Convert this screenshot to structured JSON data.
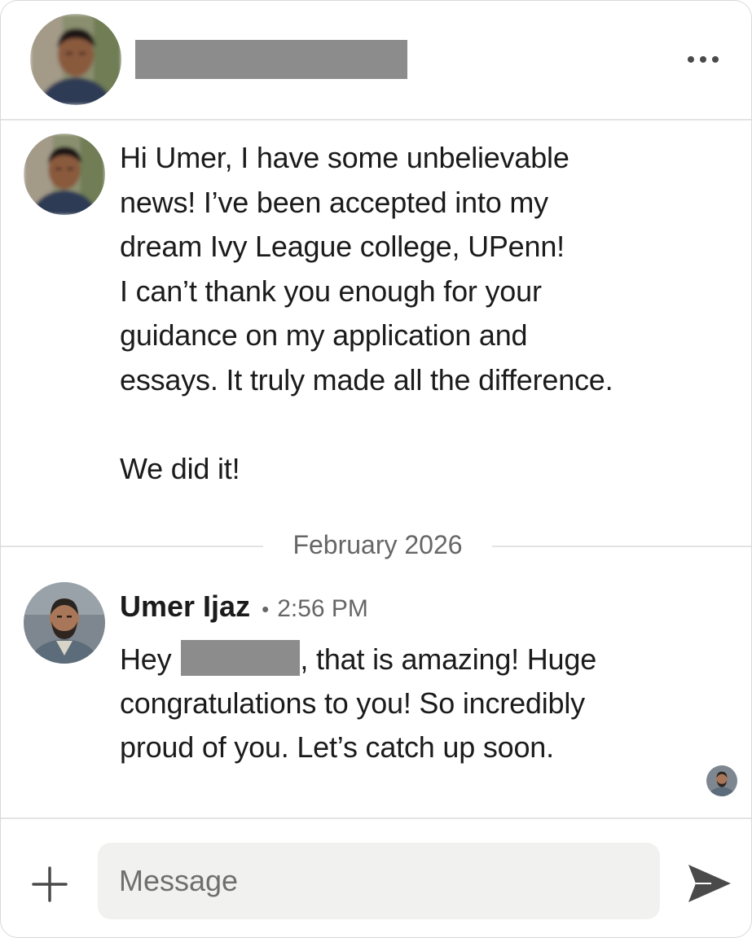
{
  "header": {
    "contact_name_redacted": true,
    "more_icon": "ellipsis-icon"
  },
  "messages": [
    {
      "body": "Hi Umer, I have some unbelievable\nnews! I’ve been accepted into my\ndream Ivy League college, UPenn!\nI can’t thank you enough for your\nguidance on my application and\nessays. It truly made all the difference.\n\nWe did it!"
    },
    {
      "sender": "Umer Ijaz",
      "separator": "•",
      "time": "2:56 PM",
      "body_before": "Hey",
      "body_after": ", that is amazing! Huge\ncongratulations to you! So incredibly\nproud of you. Let’s catch up soon."
    }
  ],
  "date_separator": "February 2026",
  "composer": {
    "placeholder": "Message",
    "attach_icon": "plus-icon",
    "send_icon": "send-icon"
  },
  "colors": {
    "text": "#1b1b1b",
    "muted": "#666666",
    "divider": "#e3e3e3",
    "input_bg": "#f1f1ef",
    "redaction": "#8c8c8c"
  }
}
